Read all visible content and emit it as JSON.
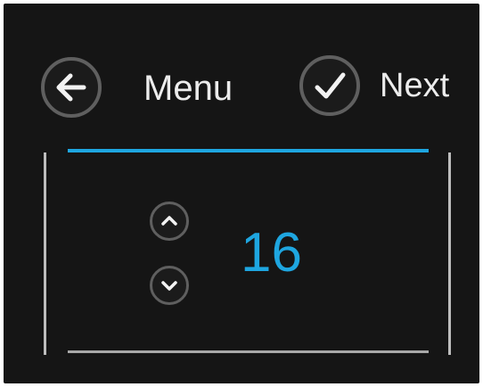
{
  "header": {
    "back_icon": "arrow-left-icon",
    "menu_label": "Menu",
    "next_icon": "check-icon",
    "next_label": "Next"
  },
  "stepper": {
    "up_icon": "chevron-up-icon",
    "down_icon": "chevron-down-icon",
    "value": "16"
  },
  "colors": {
    "background": "#151515",
    "accent": "#1ea6e0",
    "text": "#ececec"
  }
}
